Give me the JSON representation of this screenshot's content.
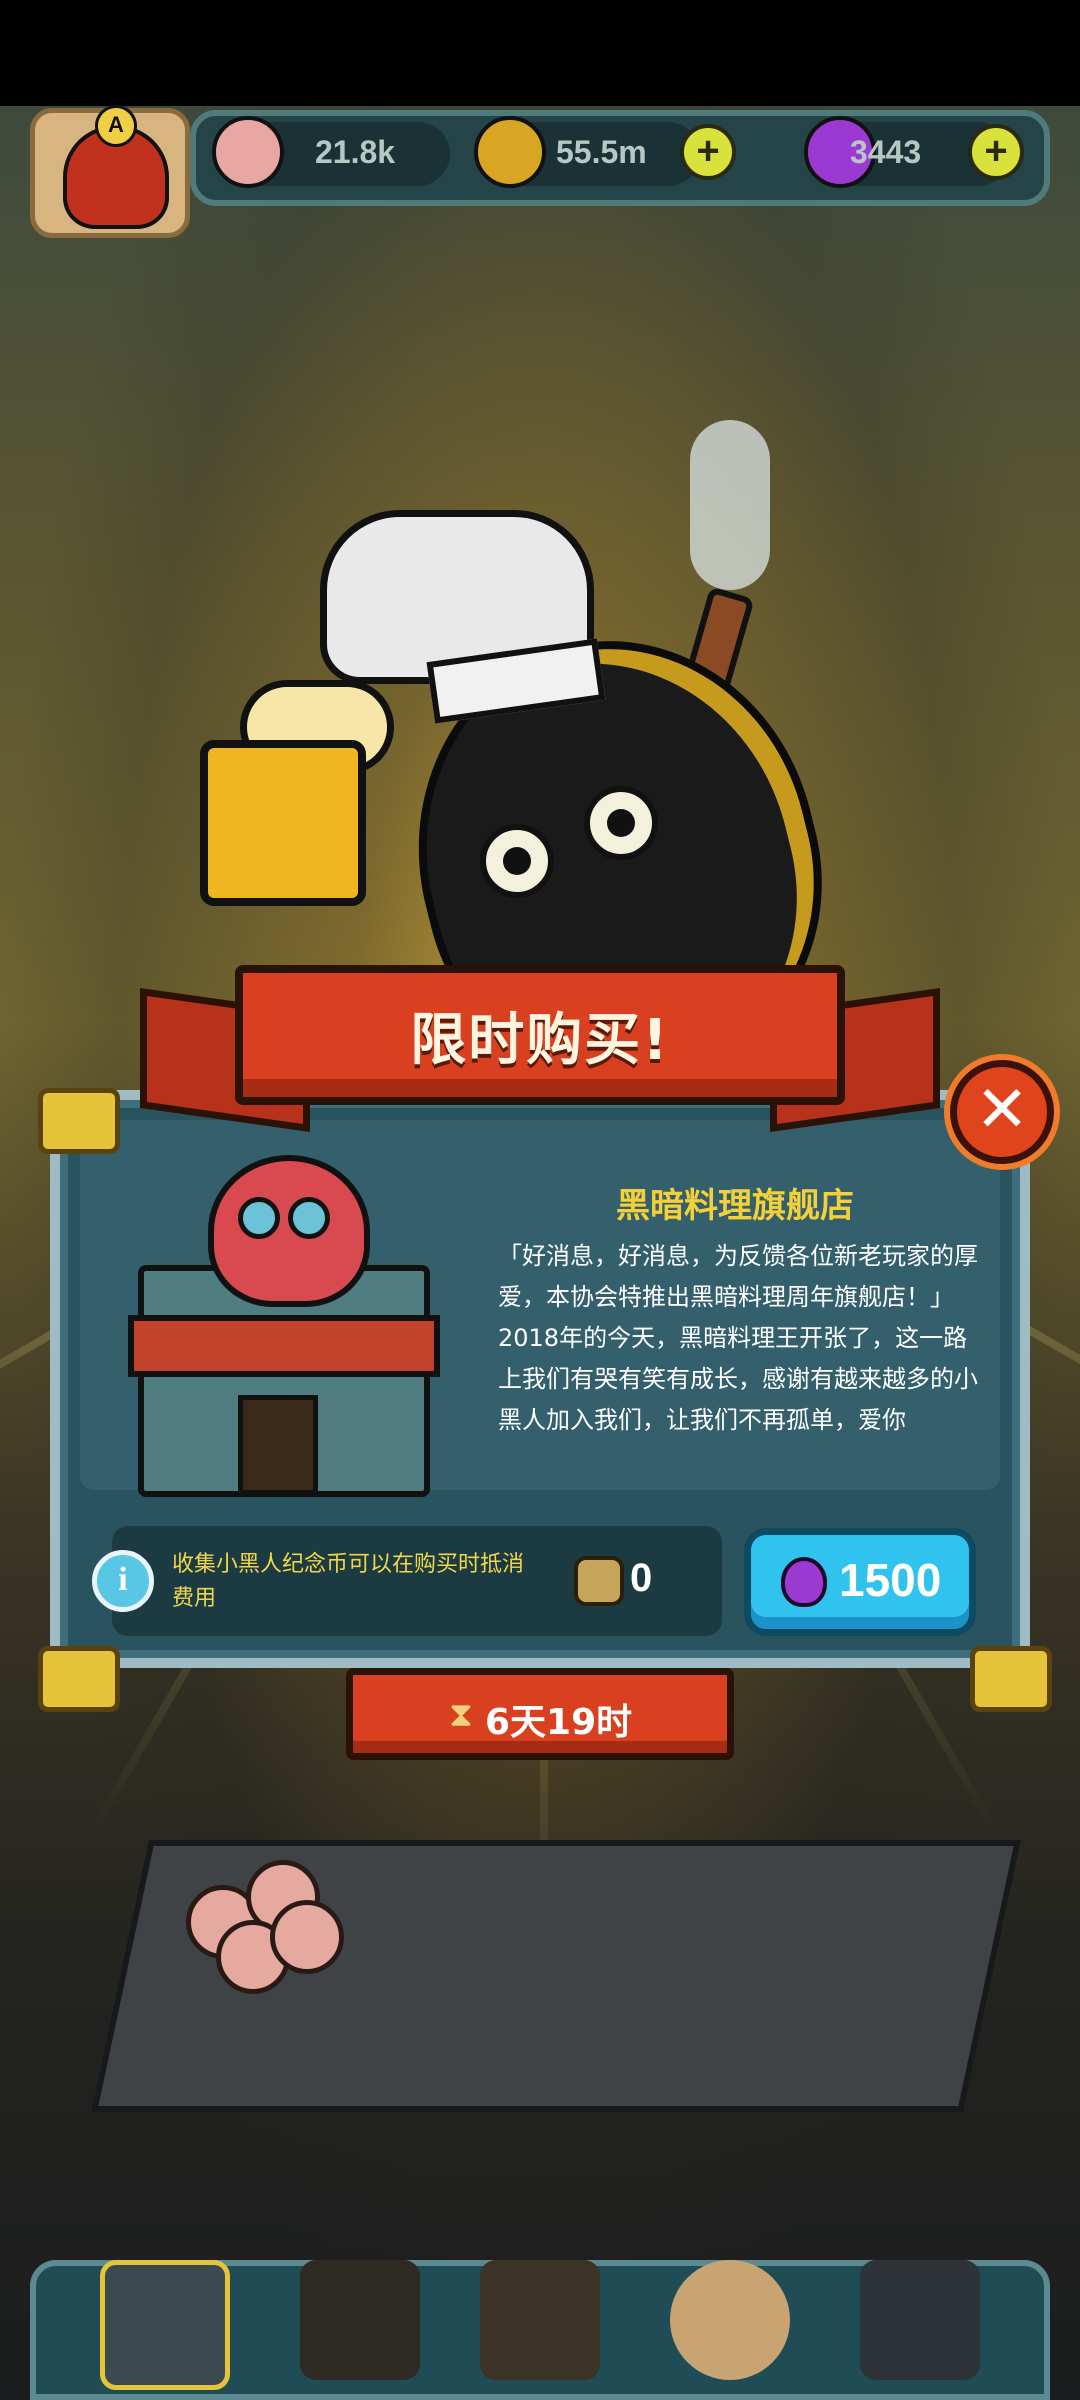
{
  "top_bar": {
    "rank_badge_letter": "A",
    "eyeballs": "21.8k",
    "coins": "55.5m",
    "potions": "3443",
    "plus_symbol": "+"
  },
  "popup": {
    "title": "限时购买!",
    "close_symbol": "✕",
    "shop_name": "黑暗料理旗舰店",
    "description": "「好消息，好消息，为反馈各位新老玩家的厚爱，本协会特推出黑暗料理周年旗舰店！」2018年的今天，黑暗料理王开张了，这一路上我们有哭有笑有成长，感谢有越来越多的小黑人加入我们，让我们不再孤单，爱你",
    "info_text": "收集小黑人纪念币可以在购买时抵消费用",
    "commemorative_coins": "0",
    "price": "1500",
    "timer": "6天19时",
    "hourglass_symbol": "⧗",
    "info_symbol": "i"
  },
  "colors": {
    "ribbon_red": "#d8401f",
    "panel_teal": "#2a5360",
    "title_gold": "#f4d03a",
    "buy_button_blue": "#2fc3ee"
  },
  "icons": {
    "eyeball": "eyeball-icon",
    "coin": "gold-coin-icon",
    "potion": "purple-potion-icon",
    "commemorative_coin": "black-guy-coin-icon"
  }
}
